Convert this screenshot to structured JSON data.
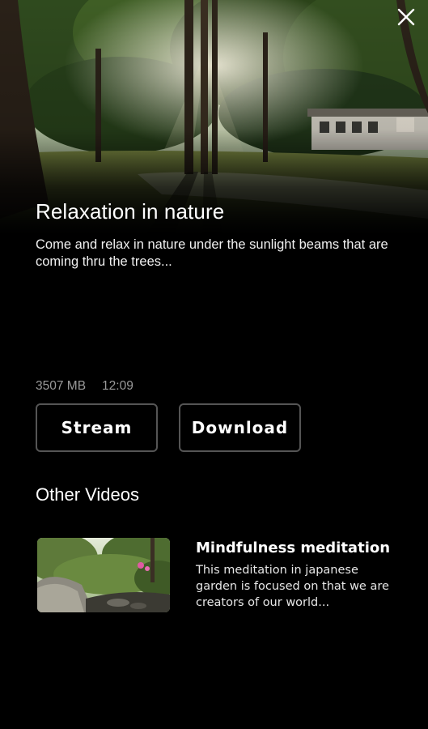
{
  "header": {
    "close_icon": "close-icon"
  },
  "video": {
    "title": "Relaxation in nature",
    "description": "Come and relax in nature under the sunlight beams that are coming thru the trees...",
    "size": "3507 MB",
    "duration": "12:09"
  },
  "actions": {
    "stream_label": "Stream",
    "download_label": "Download"
  },
  "other_videos": {
    "heading": "Other Videos",
    "items": [
      {
        "title": "Mindfulness meditation",
        "description": "This meditation in japanese garden is focused on that we are creators of our world..."
      }
    ]
  },
  "colors": {
    "background": "#000000",
    "button_border": "#555555",
    "meta_text": "#9a9a9a"
  }
}
